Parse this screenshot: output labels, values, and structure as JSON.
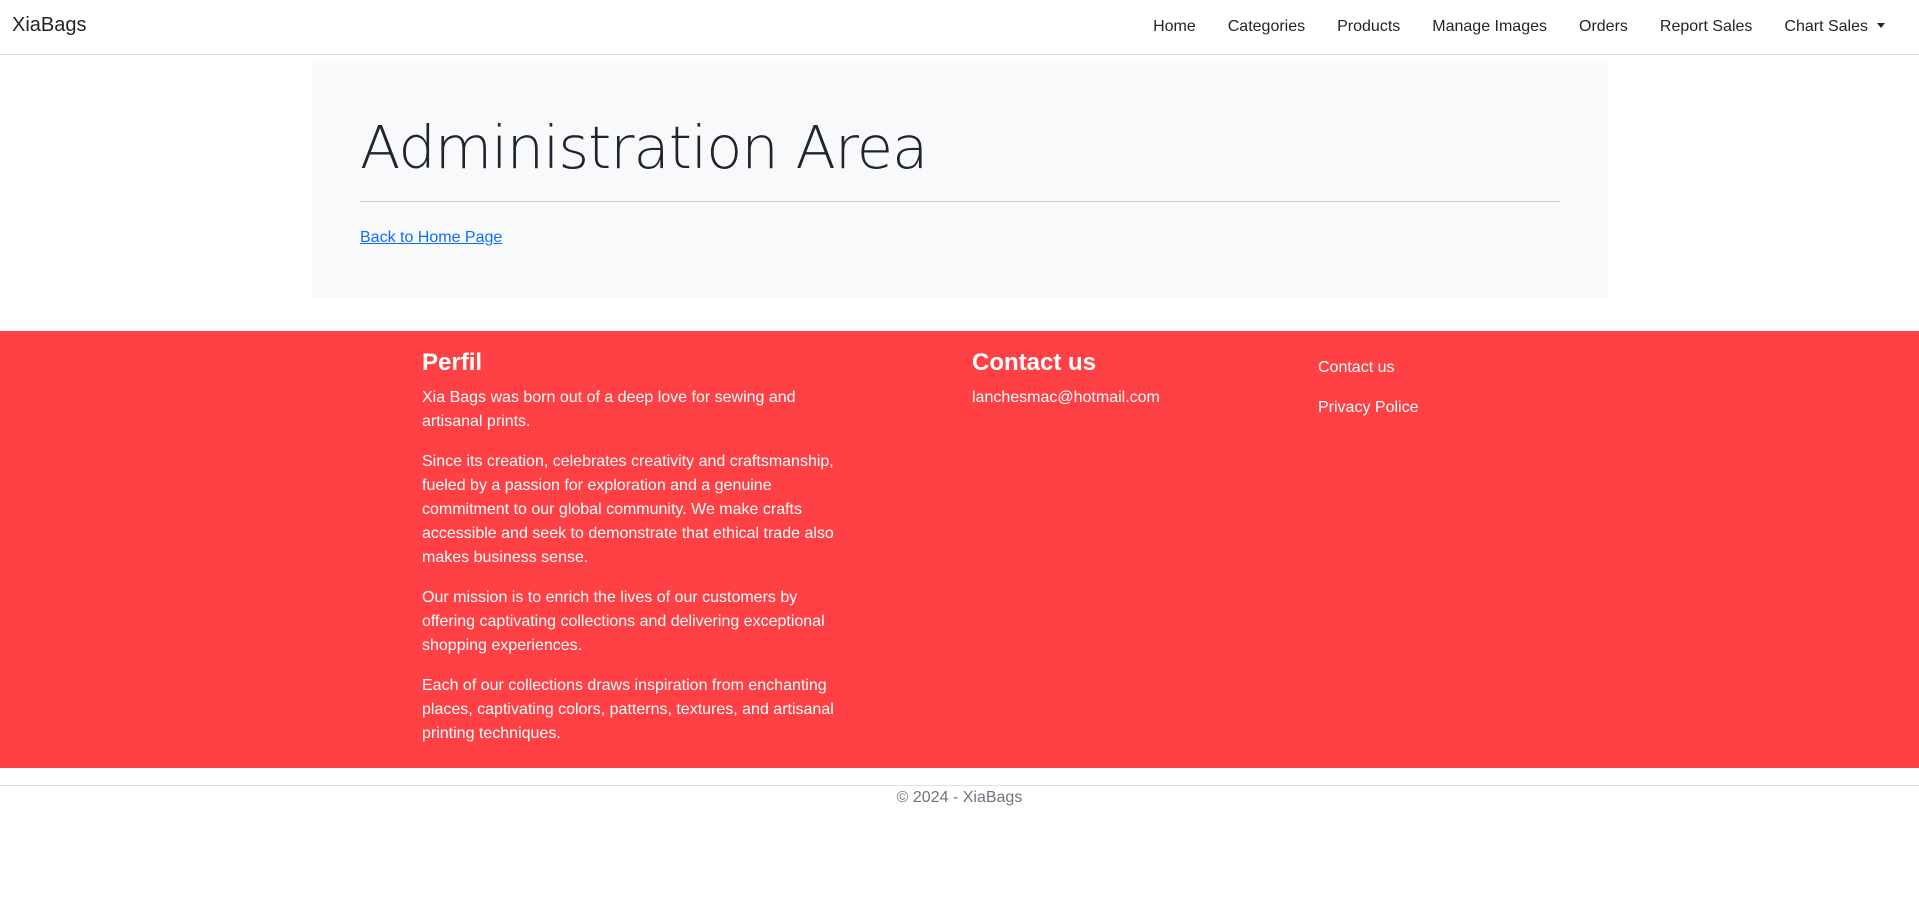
{
  "navbar": {
    "brand": "XiaBags",
    "links": [
      {
        "label": "Home"
      },
      {
        "label": "Categories"
      },
      {
        "label": "Products"
      },
      {
        "label": "Manage Images"
      },
      {
        "label": "Orders"
      },
      {
        "label": "Report Sales"
      },
      {
        "label": "Chart Sales"
      }
    ]
  },
  "admin": {
    "title": "Administration Area",
    "back_link": "Back to Home Page"
  },
  "footer": {
    "perfil": {
      "heading": "Perfil",
      "paragraphs": [
        "Xia Bags was born out of a deep love for sewing and artisanal prints.",
        "Since its creation, celebrates creativity and craftsmanship, fueled by a passion for exploration and a genuine commitment to our global community. We make crafts accessible and seek to demonstrate that ethical trade also makes business sense.",
        "Our mission is to enrich the lives of our customers by offering captivating collections and delivering exceptional shopping experiences.",
        "Each of our collections draws inspiration from enchanting places, captivating colors, patterns, textures, and artisanal printing techniques."
      ]
    },
    "contact": {
      "heading": "Contact us",
      "email": "lanchesmac@hotmail.com"
    },
    "links": [
      {
        "label": "Contact us"
      },
      {
        "label": "Privacy Police"
      }
    ],
    "copyright": "© 2024 - XiaBags"
  },
  "colors": {
    "footer_background": "#ff4044",
    "link": "#0d6efd",
    "panel_background": "#f8f9fa"
  }
}
